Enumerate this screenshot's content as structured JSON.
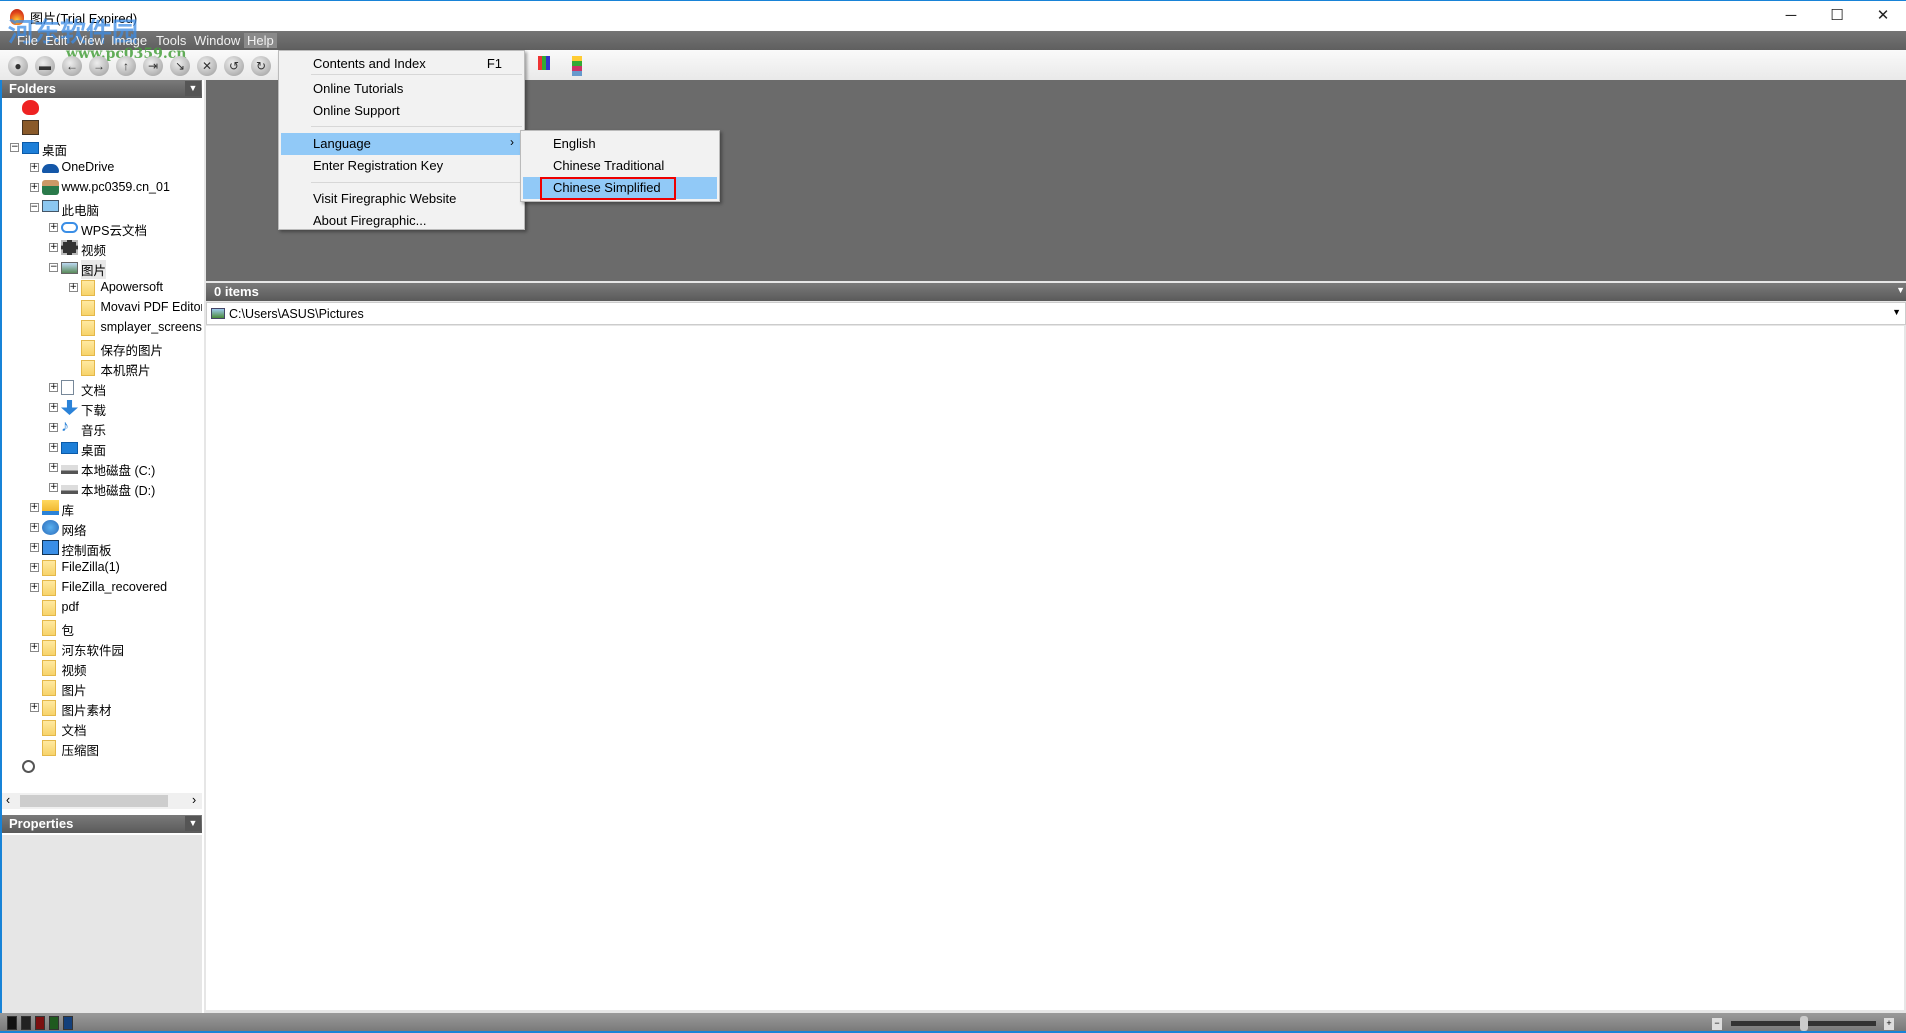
{
  "window": {
    "title": "图片(Trial Expired)",
    "minimize": "─",
    "maximize": "☐",
    "close": "✕"
  },
  "watermark": {
    "line1": "河东软件园",
    "line2": "www.pc0359.cn"
  },
  "menubar": [
    "File",
    "Edit",
    "View",
    "Image",
    "Tools",
    "Window",
    "Help"
  ],
  "toolbar": [
    {
      "icon": "refresh-icon",
      "g": "●"
    },
    {
      "icon": "scanner-icon",
      "g": "▬"
    },
    {
      "icon": "back-icon",
      "g": "←"
    },
    {
      "icon": "forward-icon",
      "g": "→"
    },
    {
      "icon": "up-folder-icon",
      "g": "↑"
    },
    {
      "icon": "move-to-icon",
      "g": "⇥"
    },
    {
      "icon": "copy-to-icon",
      "g": "↘"
    },
    {
      "icon": "delete-icon",
      "g": "✕"
    },
    {
      "icon": "rotate-left-icon",
      "g": "↺"
    },
    {
      "icon": "rotate-right-icon",
      "g": "↻"
    }
  ],
  "folders_panel": {
    "title": "Folders"
  },
  "tree": [
    {
      "label": "",
      "level": 0,
      "exp": "",
      "icon": "favorites-heart-icon"
    },
    {
      "label": "",
      "level": 0,
      "exp": "",
      "icon": "briefcase-icon"
    },
    {
      "label": "桌面",
      "level": 0,
      "exp": "-",
      "icon": "desktop-icon"
    },
    {
      "label": "OneDrive",
      "level": 1,
      "exp": "+",
      "icon": "onedrive-icon"
    },
    {
      "label": "www.pc0359.cn_01",
      "level": 1,
      "exp": "+",
      "icon": "user-icon"
    },
    {
      "label": "此电脑",
      "level": 1,
      "exp": "-",
      "icon": "computer-icon"
    },
    {
      "label": "WPS云文档",
      "level": 2,
      "exp": "+",
      "icon": "cloud-icon"
    },
    {
      "label": "视频",
      "level": 2,
      "exp": "+",
      "icon": "video-icon"
    },
    {
      "label": "图片",
      "level": 2,
      "exp": "-",
      "icon": "pictures-icon",
      "selected": true
    },
    {
      "label": "Apowersoft",
      "level": 3,
      "exp": "+",
      "icon": "folder-icon"
    },
    {
      "label": "Movavi PDF Editor",
      "level": 3,
      "exp": "",
      "icon": "folder-icon"
    },
    {
      "label": "smplayer_screenshots",
      "level": 3,
      "exp": "",
      "icon": "folder-icon"
    },
    {
      "label": "保存的图片",
      "level": 3,
      "exp": "",
      "icon": "folder-icon"
    },
    {
      "label": "本机照片",
      "level": 3,
      "exp": "",
      "icon": "folder-icon"
    },
    {
      "label": "文档",
      "level": 2,
      "exp": "+",
      "icon": "documents-icon"
    },
    {
      "label": "下载",
      "level": 2,
      "exp": "+",
      "icon": "download-icon"
    },
    {
      "label": "音乐",
      "level": 2,
      "exp": "+",
      "icon": "music-icon"
    },
    {
      "label": "桌面",
      "level": 2,
      "exp": "+",
      "icon": "desktop-icon"
    },
    {
      "label": "本地磁盘 (C:)",
      "level": 2,
      "exp": "+",
      "icon": "drive-icon"
    },
    {
      "label": "本地磁盘 (D:)",
      "level": 2,
      "exp": "+",
      "icon": "drive-icon"
    },
    {
      "label": "库",
      "level": 1,
      "exp": "+",
      "icon": "library-icon"
    },
    {
      "label": "网络",
      "level": 1,
      "exp": "+",
      "icon": "network-icon"
    },
    {
      "label": "控制面板",
      "level": 1,
      "exp": "+",
      "icon": "control-panel-icon"
    },
    {
      "label": "FileZilla(1)",
      "level": 1,
      "exp": "+",
      "icon": "folder-icon"
    },
    {
      "label": "FileZilla_recovered",
      "level": 1,
      "exp": "+",
      "icon": "folder-icon"
    },
    {
      "label": "pdf",
      "level": 1,
      "exp": "",
      "icon": "folder-icon"
    },
    {
      "label": "包",
      "level": 1,
      "exp": "",
      "icon": "folder-icon"
    },
    {
      "label": "河东软件园",
      "level": 1,
      "exp": "+",
      "icon": "folder-icon"
    },
    {
      "label": "视频",
      "level": 1,
      "exp": "",
      "icon": "folder-icon"
    },
    {
      "label": "图片",
      "level": 1,
      "exp": "",
      "icon": "folder-icon"
    },
    {
      "label": "图片素材",
      "level": 1,
      "exp": "+",
      "icon": "folder-icon"
    },
    {
      "label": "文档",
      "level": 1,
      "exp": "",
      "icon": "folder-icon"
    },
    {
      "label": "压缩图",
      "level": 1,
      "exp": "",
      "icon": "folder-icon"
    },
    {
      "label": "",
      "level": 0,
      "exp": "",
      "icon": "search-icon"
    }
  ],
  "properties_panel": {
    "title": "Properties"
  },
  "items_header": "0 items",
  "path": "C:\\Users\\ASUS\\Pictures",
  "help_menu": {
    "items": [
      {
        "label": "Contents and Index",
        "shortcut": "F1"
      },
      {
        "label": "Online Tutorials"
      },
      {
        "label": "Online Support"
      },
      {
        "label": "Language",
        "submenu": true,
        "highlighted": true
      },
      {
        "label": "Enter Registration Key"
      },
      {
        "label": "Visit Firegraphic Website"
      },
      {
        "label": "About Firegraphic..."
      }
    ]
  },
  "language_submenu": {
    "items": [
      "English",
      "Chinese Traditional",
      "Chinese Simplified"
    ],
    "highlighted": "Chinese Simplified"
  },
  "colors": {
    "accent": "#1883d7",
    "highlight": "#91c9f7",
    "annotation": "#e00000",
    "dark_area": "#6b6b6b"
  }
}
